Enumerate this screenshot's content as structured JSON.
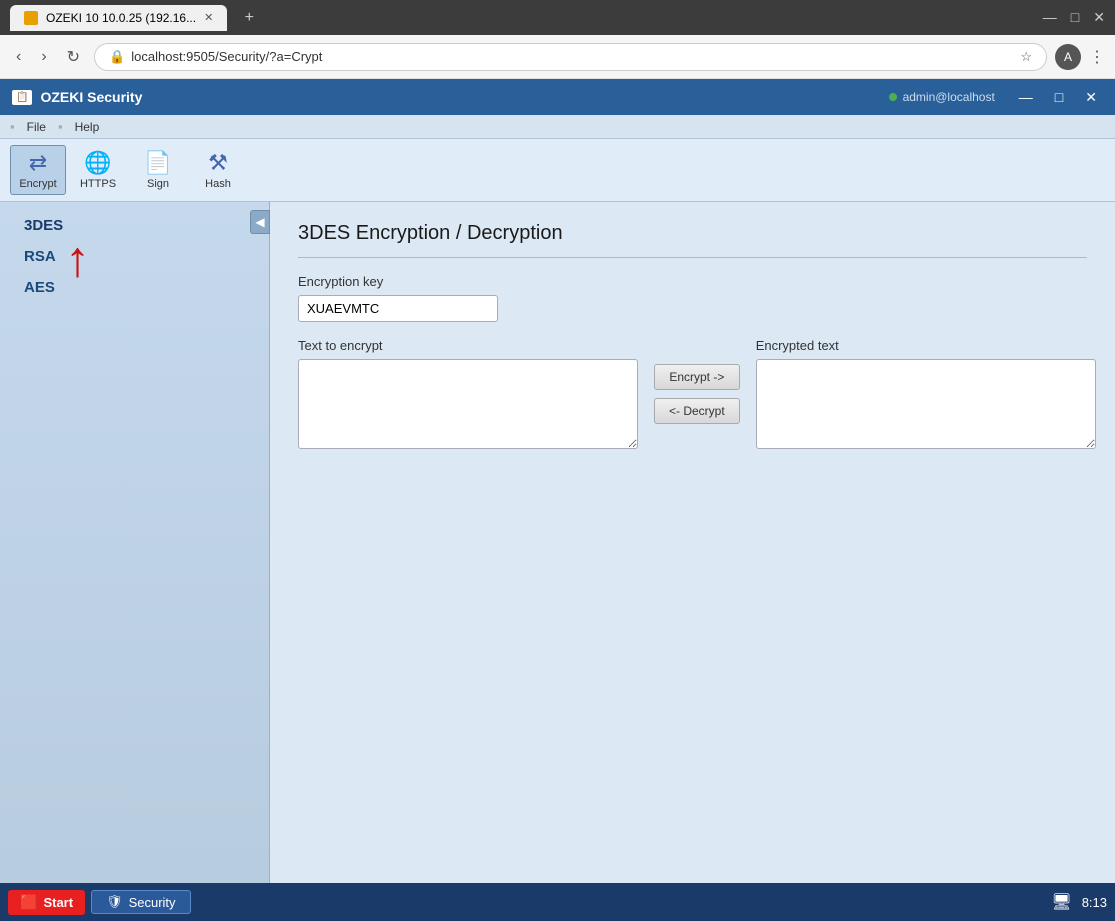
{
  "browser": {
    "tab_title": "OZEKI 10 10.0.25 (192.16...",
    "tab_favicon": "O",
    "url": "localhost:9505/Security/?a=Crypt",
    "profile_initial": "A"
  },
  "app": {
    "title": "OZEKI Security",
    "user": "admin@localhost",
    "menus": [
      {
        "label": "File"
      },
      {
        "label": "Help"
      }
    ],
    "toolbar": {
      "buttons": [
        {
          "id": "encrypt",
          "label": "Encrypt",
          "icon": "⇄"
        },
        {
          "id": "https",
          "label": "HTTPS",
          "icon": "🌐"
        },
        {
          "id": "sign",
          "label": "Sign",
          "icon": "📄"
        },
        {
          "id": "hash",
          "label": "Hash",
          "icon": "⚒"
        }
      ]
    }
  },
  "sidebar": {
    "items": [
      {
        "id": "3des",
        "label": "3DES",
        "active": true
      },
      {
        "id": "rsa",
        "label": "RSA",
        "active": false
      },
      {
        "id": "aes",
        "label": "AES",
        "active": false
      }
    ],
    "collapse_icon": "◀"
  },
  "main": {
    "page_title": "3DES Encryption / Decryption",
    "encryption_key_label": "Encryption key",
    "encryption_key_value": "XUAEVMTC",
    "text_to_encrypt_label": "Text to encrypt",
    "encrypted_text_label": "Encrypted text",
    "encrypt_button": "Encrypt ->",
    "decrypt_button": "<- Decrypt"
  },
  "taskbar": {
    "start_label": "Start",
    "app_label": "Security",
    "clock": "8:13"
  },
  "window_controls": {
    "minimize": "—",
    "maximize": "□",
    "close": "✕"
  }
}
